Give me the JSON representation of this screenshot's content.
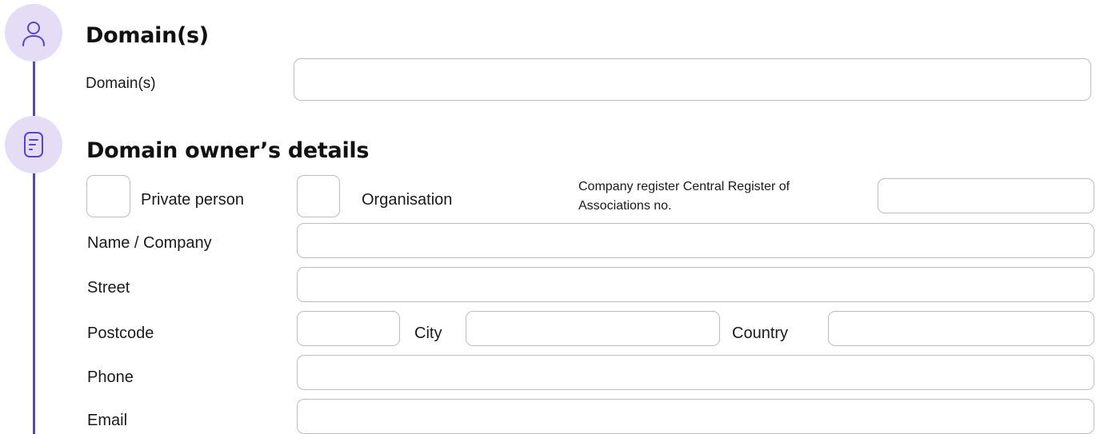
{
  "timeline": {
    "steps": [
      {
        "icon": "user-icon"
      },
      {
        "icon": "document-icon"
      }
    ],
    "accent_color": "#5b3fd6",
    "circle_color": "#e5dcf6"
  },
  "domains_section": {
    "title": "Domain(s)",
    "domains_label": "Domain(s)",
    "domains_value": ""
  },
  "owner_section": {
    "title": "Domain owner’s details",
    "private_person_label": "Private person",
    "organisation_label": "Organisation",
    "register_label": "Company register Central Register of Associations no.",
    "register_value": "",
    "name_label": "Name / Company",
    "name_value": "",
    "street_label": "Street",
    "street_value": "",
    "postcode_label": "Postcode",
    "postcode_value": "",
    "city_label": "City",
    "city_value": "",
    "country_label": "Country",
    "country_value": "",
    "phone_label": "Phone",
    "phone_value": "",
    "email_label": "Email",
    "email_value": ""
  }
}
